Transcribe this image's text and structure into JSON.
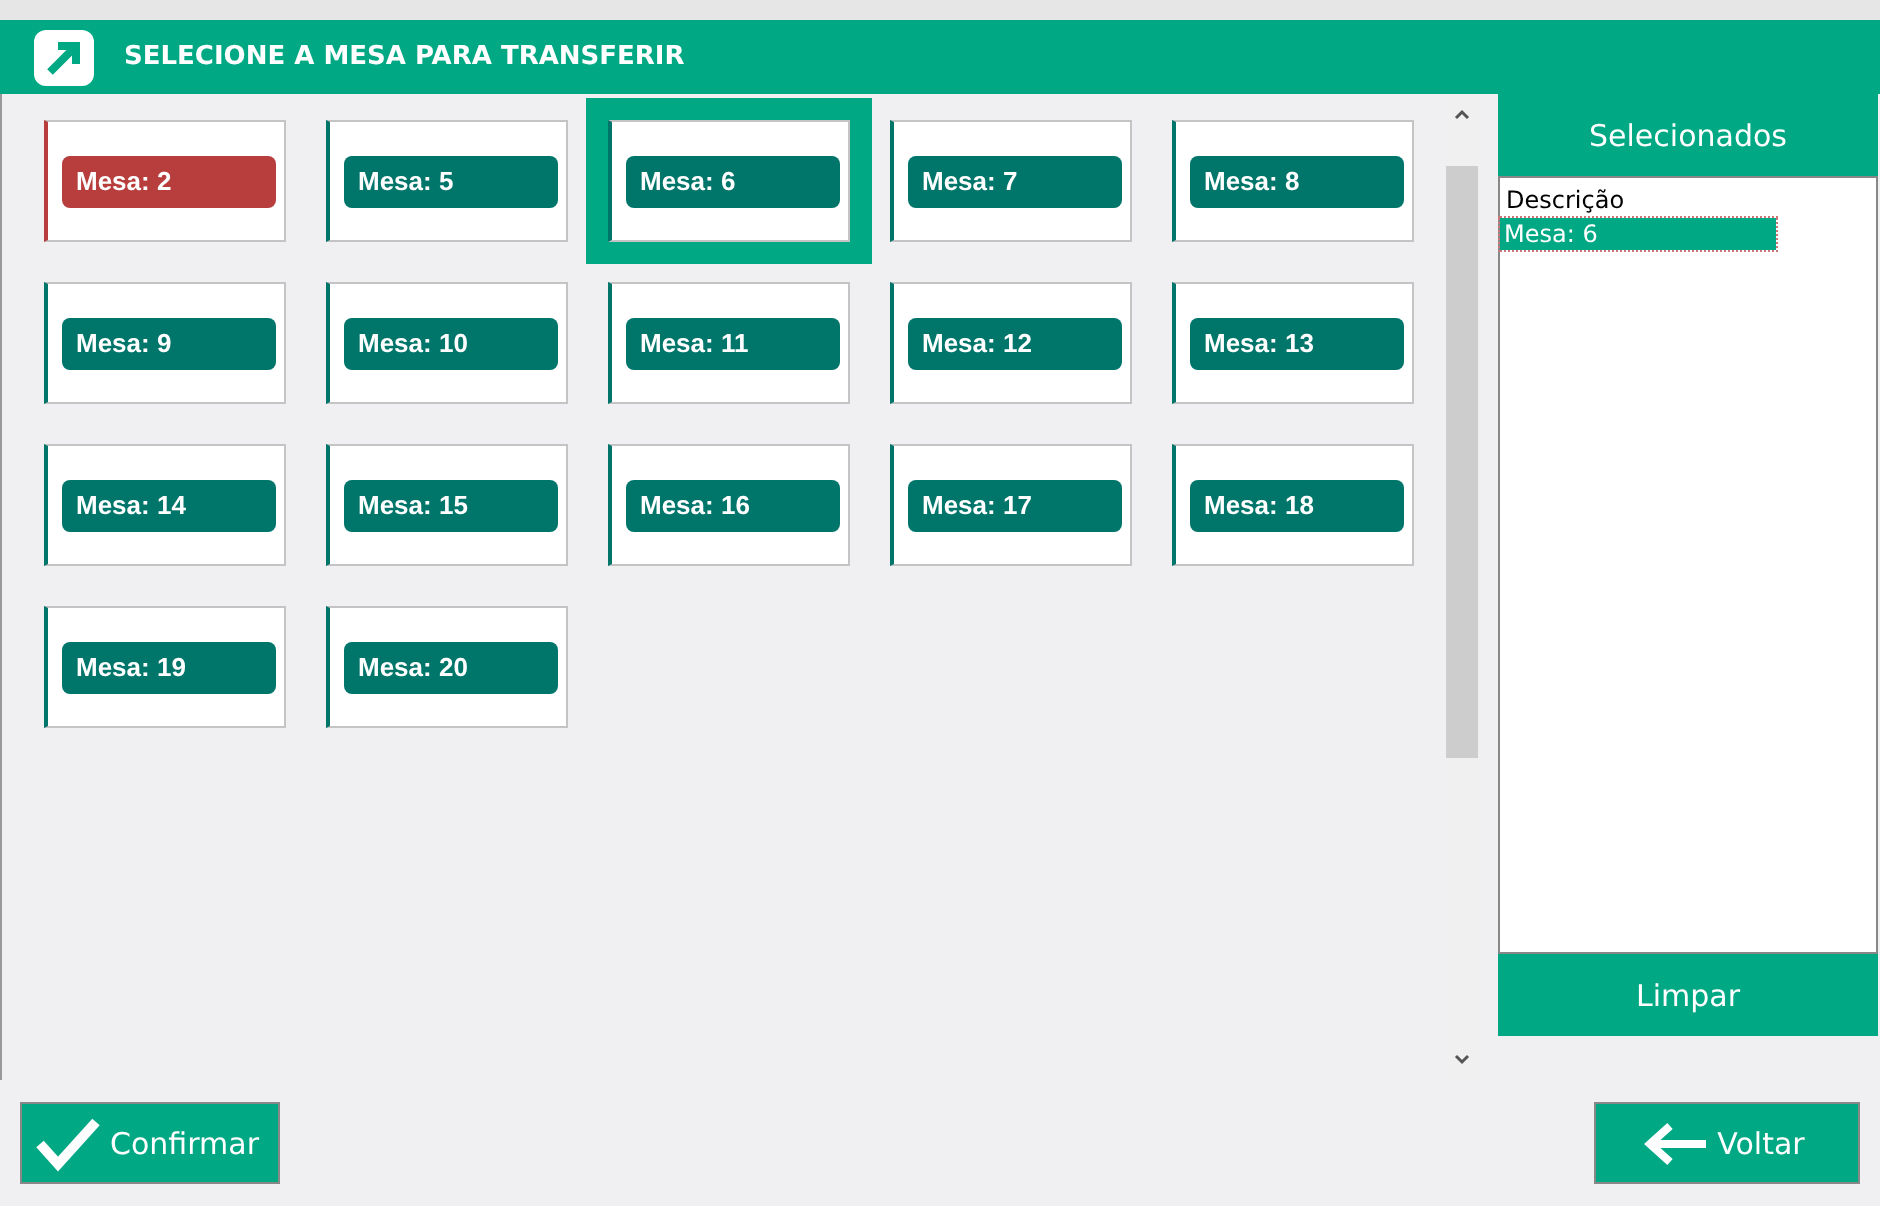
{
  "window": {
    "title": "SELECIONE A MESA PARA TRANSFERIR"
  },
  "tables": [
    {
      "label": "Mesa: 2",
      "color": "#b83e3e",
      "selected": false
    },
    {
      "label": "Mesa: 5",
      "color": "#00756a",
      "selected": false
    },
    {
      "label": "Mesa: 6",
      "color": "#00756a",
      "selected": true
    },
    {
      "label": "Mesa: 7",
      "color": "#00756a",
      "selected": false
    },
    {
      "label": "Mesa: 8",
      "color": "#00756a",
      "selected": false
    },
    {
      "label": "Mesa: 9",
      "color": "#00756a",
      "selected": false
    },
    {
      "label": "Mesa: 10",
      "color": "#00756a",
      "selected": false
    },
    {
      "label": "Mesa: 11",
      "color": "#00756a",
      "selected": false
    },
    {
      "label": "Mesa: 12",
      "color": "#00756a",
      "selected": false
    },
    {
      "label": "Mesa: 13",
      "color": "#00756a",
      "selected": false
    },
    {
      "label": "Mesa: 14",
      "color": "#00756a",
      "selected": false
    },
    {
      "label": "Mesa: 15",
      "color": "#00756a",
      "selected": false
    },
    {
      "label": "Mesa: 16",
      "color": "#00756a",
      "selected": false
    },
    {
      "label": "Mesa: 17",
      "color": "#00756a",
      "selected": false
    },
    {
      "label": "Mesa: 18",
      "color": "#00756a",
      "selected": false
    },
    {
      "label": "Mesa: 19",
      "color": "#00756a",
      "selected": false
    },
    {
      "label": "Mesa: 20",
      "color": "#00756a",
      "selected": false
    }
  ],
  "selected_panel": {
    "title": "Selecionados",
    "column": "Descrição",
    "items": [
      {
        "label": "Mesa: 6",
        "selected": true
      }
    ],
    "clear_button": "Limpar"
  },
  "buttons": {
    "confirm": "Confirmar",
    "back": "Voltar"
  }
}
